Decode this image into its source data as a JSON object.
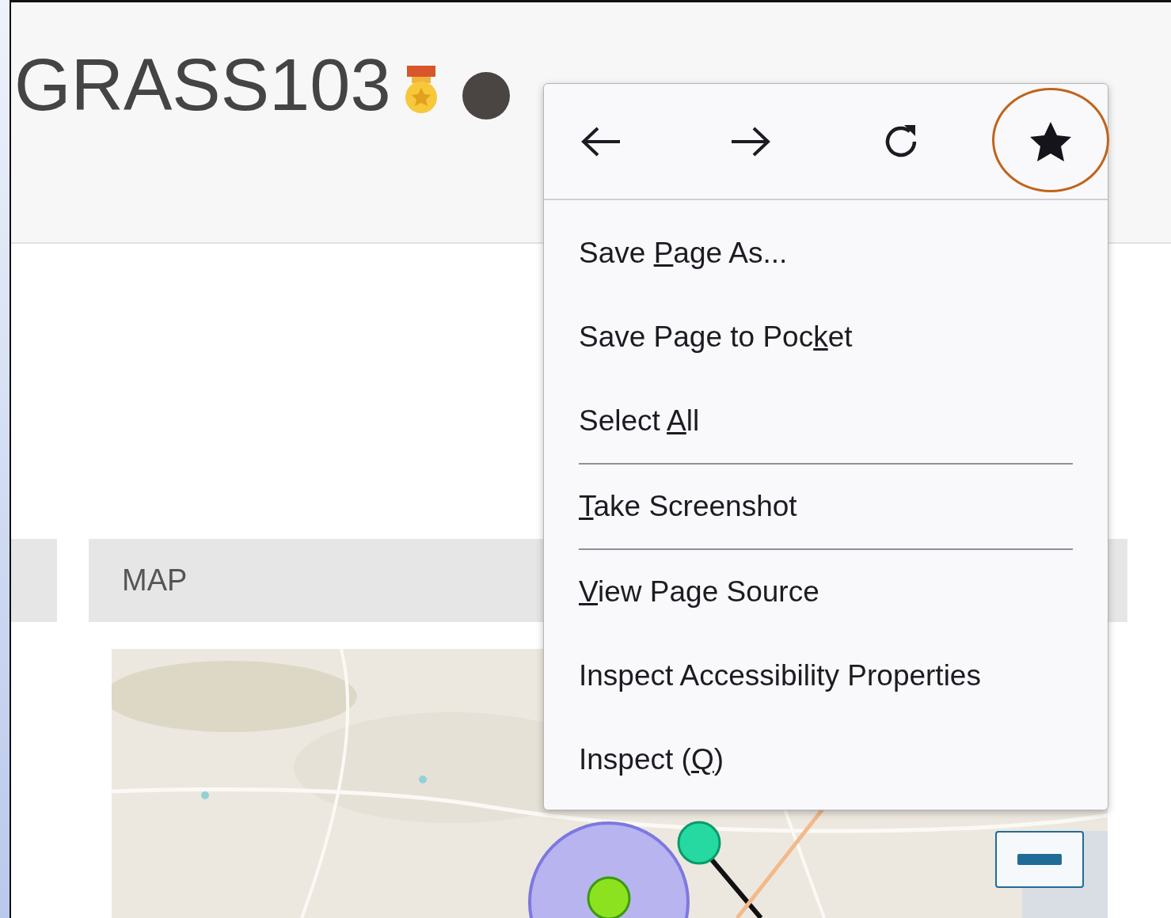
{
  "header": {
    "title": "GRASS103"
  },
  "panel": {
    "title": "MAP"
  },
  "context_menu": {
    "nav": [
      {
        "kind": "back",
        "highlighted": false
      },
      {
        "kind": "forward",
        "highlighted": false
      },
      {
        "kind": "reload",
        "highlighted": false
      },
      {
        "kind": "bookmark",
        "highlighted": true
      }
    ],
    "items": [
      {
        "kind": "item",
        "before": "Save ",
        "key": "P",
        "after": "age As..."
      },
      {
        "kind": "item",
        "before": "Save Page to Poc",
        "key": "k",
        "after": "et"
      },
      {
        "kind": "item",
        "before": "Select ",
        "key": "A",
        "after": "ll"
      },
      {
        "kind": "separator"
      },
      {
        "kind": "item",
        "key": "T",
        "after": "ake Screenshot"
      },
      {
        "kind": "separator"
      },
      {
        "kind": "item",
        "key": "V",
        "after": "iew Page Source"
      },
      {
        "kind": "item",
        "before": "Inspect Accessibility Properties"
      },
      {
        "kind": "item",
        "before": "Inspect (",
        "key": "Q",
        "after": ")"
      }
    ]
  }
}
